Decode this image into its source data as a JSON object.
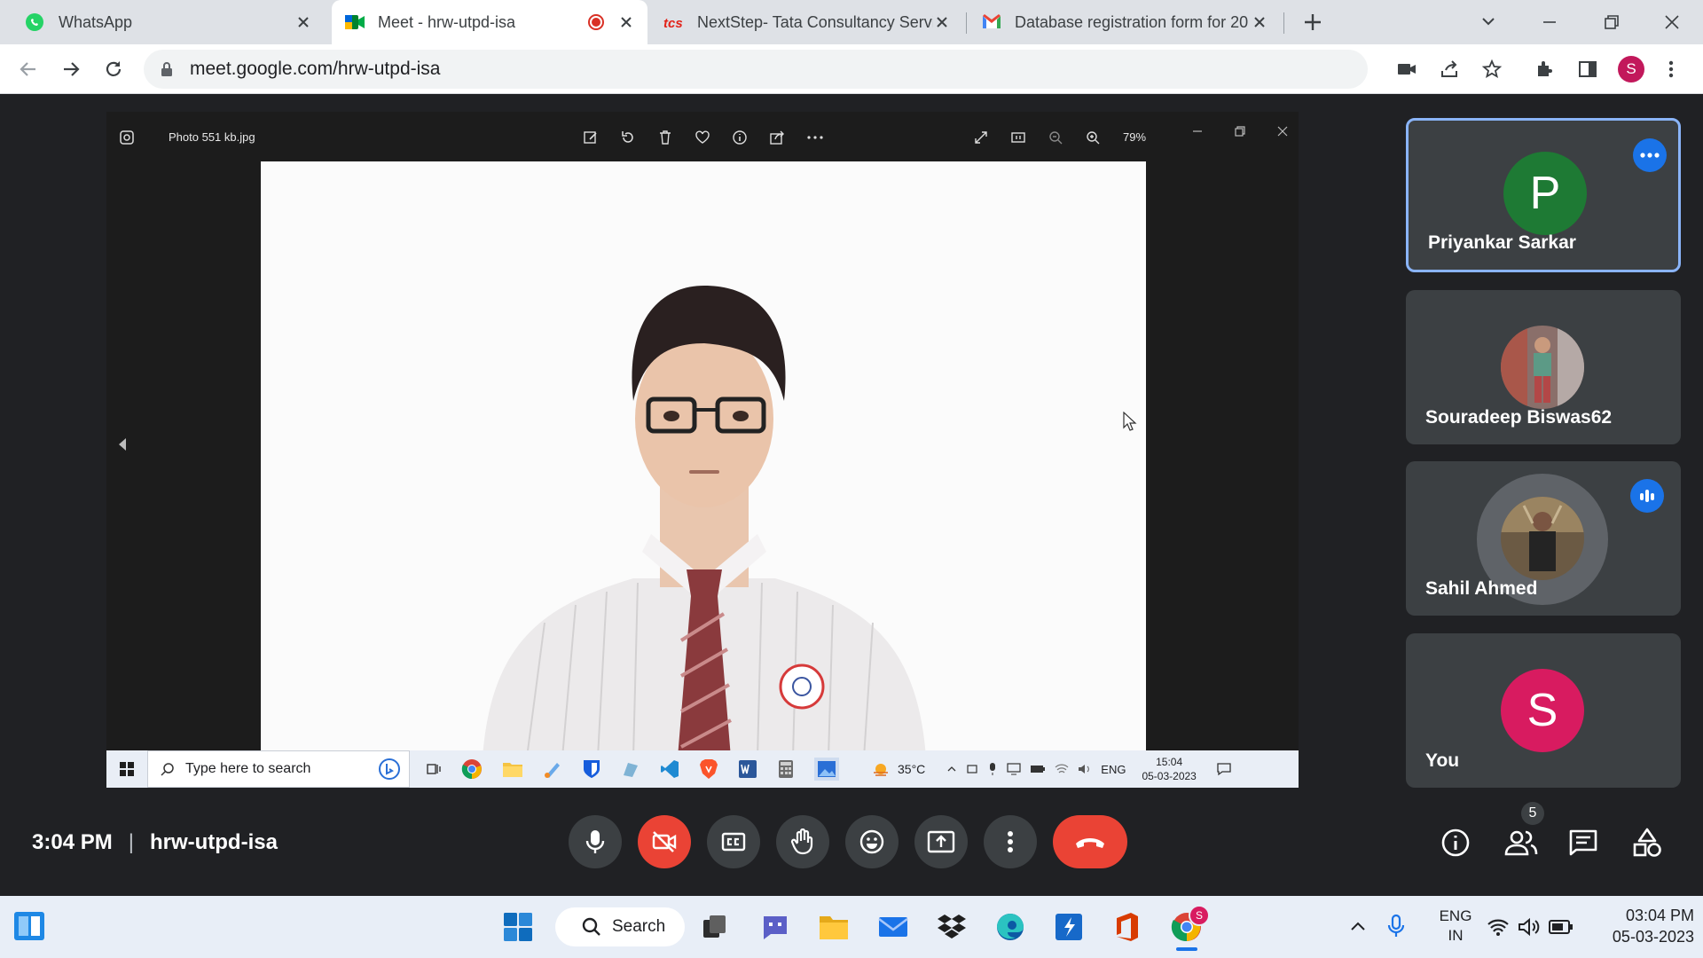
{
  "browser": {
    "tabs": [
      {
        "title": "WhatsApp",
        "active": false
      },
      {
        "title": "Meet - hrw-utpd-isa",
        "active": true,
        "recording": true
      },
      {
        "title": "NextStep- Tata Consultancy Servi",
        "active": false
      },
      {
        "title": "Database registration form for 20",
        "active": false
      }
    ],
    "url": "meet.google.com/hrw-utpd-isa",
    "profile_initial": "S"
  },
  "shared_screen": {
    "photo_title": "Photo 551 kb.jpg",
    "zoom": "79%",
    "taskbar": {
      "search_placeholder": "Type here to search",
      "weather": "35°C",
      "lang": "ENG",
      "time": "15:04",
      "date": "05-03-2023"
    }
  },
  "participants": [
    {
      "name": "Priyankar Sarkar",
      "initial": "P",
      "color": "#1e7a34",
      "active_speaker": true
    },
    {
      "name": "Souradeep Biswas62",
      "photo": true
    },
    {
      "name": "Sahil Ahmed",
      "photo": true,
      "speaking": true
    },
    {
      "name": "You",
      "initial": "S",
      "color": "#d81b60"
    }
  ],
  "meeting": {
    "time": "3:04 PM",
    "separator": "|",
    "code": "hrw-utpd-isa",
    "people_count": "5"
  },
  "taskbar": {
    "search_label": "Search",
    "lang_line1": "ENG",
    "lang_line2": "IN",
    "time": "03:04 PM",
    "date": "05-03-2023",
    "chrome_badge": "S"
  },
  "colors": {
    "accent_blue": "#8ab4f8",
    "meet_red": "#ea4335",
    "dark_bg": "#202124",
    "tile_bg": "#3c4043"
  }
}
